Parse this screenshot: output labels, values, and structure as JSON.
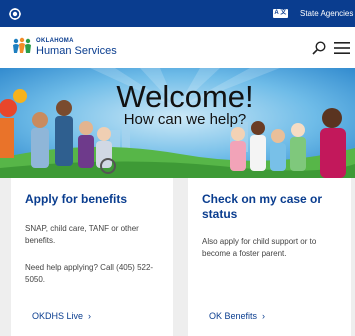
{
  "state_bar": {
    "translate_label": "A 文",
    "agencies_label": "State Agencies",
    "bg_color": "#0a3d8f"
  },
  "header": {
    "logo_top": "OKLAHOMA",
    "logo_bottom": "Human Services",
    "brand_color": "#0a3d8f"
  },
  "hero": {
    "title": "Welcome!",
    "subtitle": "How can we help?"
  },
  "cards": [
    {
      "title": "Apply for benefits",
      "text_1": "SNAP, child care, TANF or other benefits.",
      "text_2": "Need help applying? Call (405) 522-5050.",
      "link": "OKDHS Live",
      "link_chevron": "›"
    },
    {
      "title": "Check on my case or status",
      "text_1": "Also apply for child support or to become a foster parent.",
      "link": "OK Benefits",
      "link_chevron": "›"
    }
  ],
  "icons": [
    "oklahoma-seal-icon",
    "translate-icon",
    "ohs-logo-icon",
    "search-icon",
    "hamburger-menu-icon",
    "chevron-right-icon"
  ]
}
